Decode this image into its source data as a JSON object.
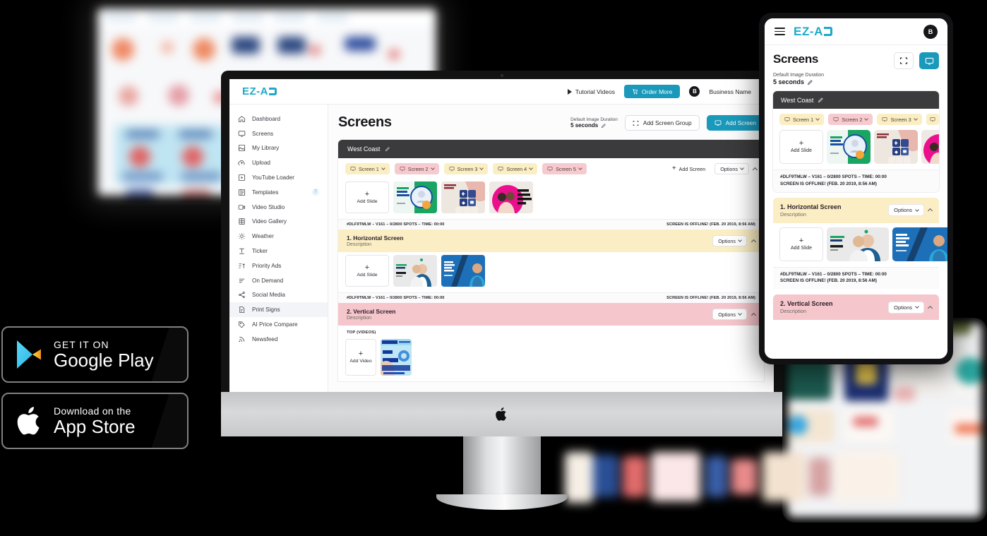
{
  "brand": {
    "name": "EZ-AD",
    "accent": "#1a99bb",
    "logo_mark": "ez-ad-logo"
  },
  "desktop": {
    "topbar": {
      "tutorial_label": "Tutorial Videos",
      "order_label": "Order More",
      "avatar_initial": "B",
      "business_label": "Business Name"
    },
    "sidebar": {
      "items": [
        {
          "label": "Dashboard",
          "icon": "home-icon",
          "active": false
        },
        {
          "label": "Screens",
          "icon": "monitor-icon",
          "active": false
        },
        {
          "label": "My Library",
          "icon": "image-icon",
          "active": false
        },
        {
          "label": "Upload",
          "icon": "cloud-upload-icon",
          "active": false
        },
        {
          "label": "YouTube Loader",
          "icon": "play-box-icon",
          "active": false
        },
        {
          "label": "Templates",
          "icon": "template-icon",
          "active": false,
          "badge": "7"
        },
        {
          "label": "Video Studio",
          "icon": "video-camera-icon",
          "active": false
        },
        {
          "label": "Video Gallery",
          "icon": "film-icon",
          "active": false
        },
        {
          "label": "Weather",
          "icon": "sun-icon",
          "active": false
        },
        {
          "label": "Ticker",
          "icon": "text-icon",
          "active": false
        },
        {
          "label": "Priority Ads",
          "icon": "sort-up-icon",
          "active": false
        },
        {
          "label": "On Demand",
          "icon": "list-icon",
          "active": false
        },
        {
          "label": "Social Media",
          "icon": "share-icon",
          "active": false
        },
        {
          "label": "Print Signs",
          "icon": "document-icon",
          "active": true
        },
        {
          "label": "AI Price Compare",
          "icon": "tag-icon",
          "active": false
        },
        {
          "label": "Newsfeed",
          "icon": "rss-icon",
          "active": false
        }
      ]
    },
    "main": {
      "page_title": "Screens",
      "duration_label": "Default Image Duration",
      "duration_value": "5 seconds",
      "add_group_label": "Add Screen Group",
      "add_screen_label": "Add Screen",
      "group_name": "West Coast",
      "screen_tabs": [
        {
          "label": "Screen 1",
          "color": "yellow"
        },
        {
          "label": "Screen 2",
          "color": "pink"
        },
        {
          "label": "Screen 3",
          "color": "yellow"
        },
        {
          "label": "Screen 4",
          "color": "yellow"
        },
        {
          "label": "Screen 5",
          "color": "pink"
        }
      ],
      "tabs_add_label": "Add Screen",
      "tabs_options_label": "Options",
      "add_slide_label": "Add Slide",
      "add_video_label": "Add Video",
      "status_left": "#DLF9TMLW – V161 – 0/2800 SPOTS – TIME: 00:00",
      "status_right": "SCREEN IS OFFLINE! (FEB. 20 2019, 8:56 AM)",
      "sections": [
        {
          "title": "1. Horizontal Screen",
          "desc": "Description",
          "options_label": "Options",
          "color": "yellow"
        },
        {
          "title": "2. Vertical Screen",
          "desc": "Description",
          "options_label": "Options",
          "color": "pink",
          "sub_label": "TOP (VIDEOS)"
        }
      ]
    }
  },
  "mobile": {
    "topbar": {
      "menu_icon": "hamburger-icon",
      "avatar_initial": "B"
    },
    "page_title": "Screens",
    "duration_label": "Default Image Duration",
    "duration_value": "5 seconds",
    "group_name": "West Coast",
    "screen_tabs": [
      {
        "label": "Screen 1",
        "color": "yellow"
      },
      {
        "label": "Screen 2",
        "color": "pink"
      },
      {
        "label": "Screen 3",
        "color": "yellow"
      }
    ],
    "add_slide_label": "Add Slide",
    "status_left": "#DLF9TMLW – V161 – 0/2800 SPOTS – TIME: 00:00",
    "status_right": "SCREEN IS OFFLINE! (FEB. 20 2019, 8:56 AM)",
    "sections": [
      {
        "title": "1. Horizontal Screen",
        "desc": "Description",
        "options_label": "Options",
        "color": "yellow"
      },
      {
        "title": "2. Vertical Screen",
        "desc": "Description",
        "options_label": "Options",
        "color": "pink"
      }
    ]
  },
  "store_badges": [
    {
      "id": "google-play",
      "small": "GET IT ON",
      "large": "Google Play"
    },
    {
      "id": "app-store",
      "small": "Download on the",
      "large": "App Store"
    }
  ]
}
